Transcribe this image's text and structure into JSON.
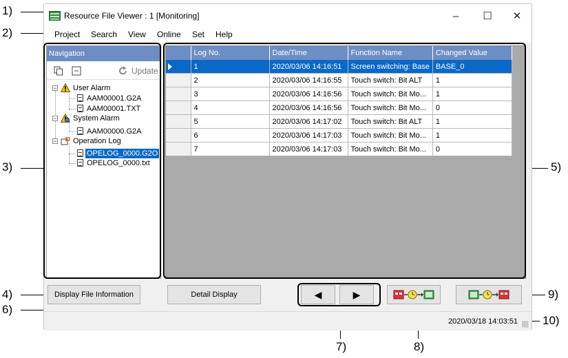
{
  "window": {
    "title": "Resource File Viewer : 1 [Monitoring]"
  },
  "menu": [
    "Project",
    "Search",
    "View",
    "Online",
    "Set",
    "Help"
  ],
  "navigation": {
    "header": "Navigation",
    "update_label": "Update",
    "tree": [
      {
        "label": "User Alarm"
      },
      {
        "label": "AAM00001.G2A"
      },
      {
        "label": "AAM00001.TXT"
      },
      {
        "label": "System Alarm"
      },
      {
        "label": "AAM00000.G2A"
      },
      {
        "label": "Operation Log"
      },
      {
        "label": "OPELOG_0000.G2O"
      },
      {
        "label": "OPELOG_0000.txt"
      }
    ]
  },
  "grid": {
    "columns": [
      "Log No.",
      "Date/Time",
      "Function Name",
      "Changed Value"
    ],
    "rows": [
      [
        "1",
        "2020/03/06 14:16:51",
        "Screen switching: Base",
        "BASE_0"
      ],
      [
        "2",
        "2020/03/06 14:16:55",
        "Touch switch: Bit ALT",
        "1"
      ],
      [
        "3",
        "2020/03/06 14:16:56",
        "Touch switch: Bit Mo...",
        "1"
      ],
      [
        "4",
        "2020/03/06 14:16:56",
        "Touch switch: Bit Mo...",
        "0"
      ],
      [
        "5",
        "2020/03/06 14:17:02",
        "Touch switch: Bit ALT",
        "1"
      ],
      [
        "6",
        "2020/03/06 14:17:03",
        "Touch switch: Bit Mo...",
        "1"
      ],
      [
        "7",
        "2020/03/06 14:17:03",
        "Touch switch: Bit Mo...",
        "0"
      ]
    ],
    "selected_row": 0
  },
  "buttons": {
    "display_file_info": "Display File Information",
    "detail_display": "Detail Display",
    "prev": "◀",
    "next": "▶"
  },
  "status": {
    "datetime": "2020/03/18 14:03:51"
  },
  "callouts": [
    "1)",
    "2)",
    "3)",
    "4)",
    "5)",
    "6)",
    "7)",
    "8)",
    "9)",
    "10)"
  ],
  "colors": {
    "accent": "#6d8ec4",
    "selection": "#0a68c7",
    "grid_bg": "#aaaaaa"
  }
}
